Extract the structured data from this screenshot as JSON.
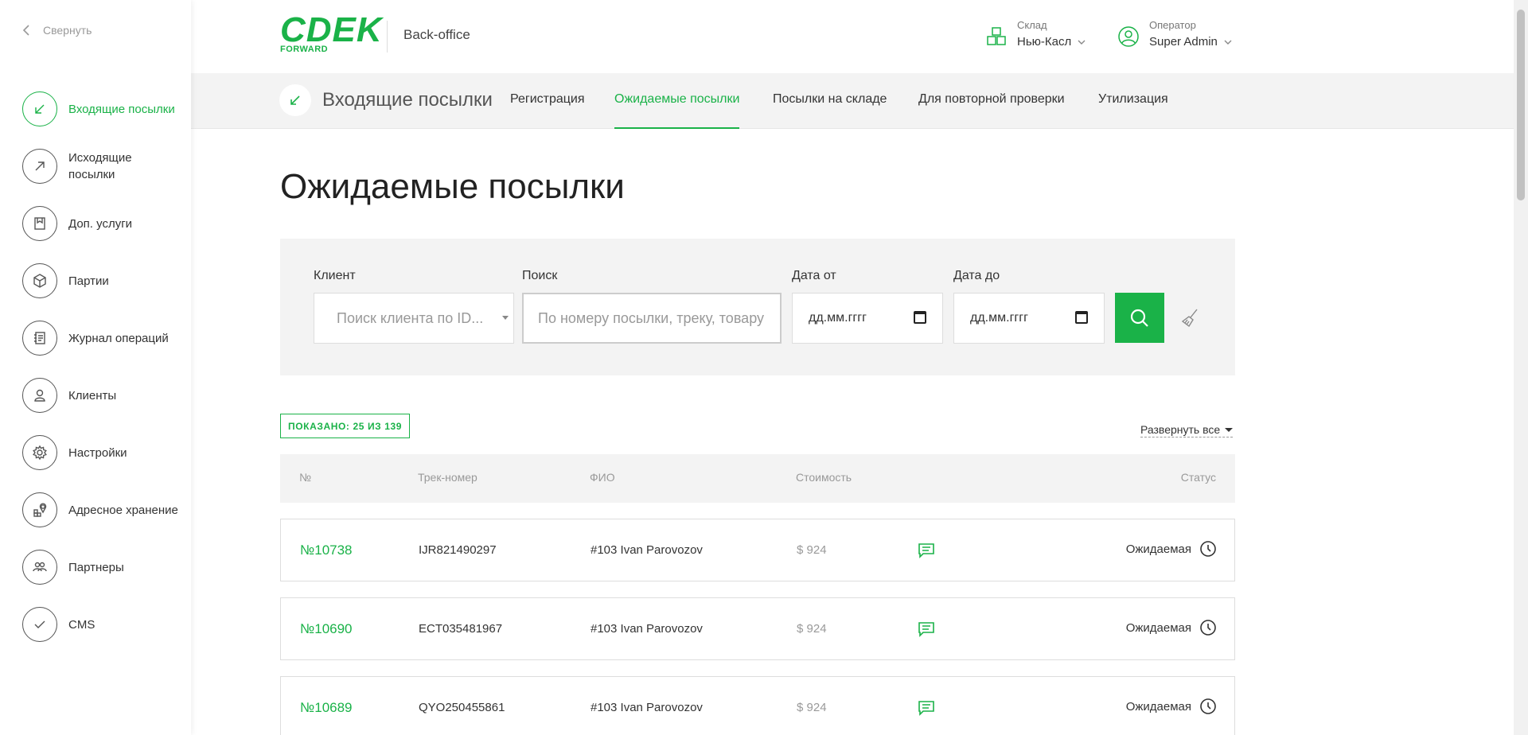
{
  "sidebar": {
    "collapse_label": "Свернуть",
    "items": [
      {
        "label": "Входящие посылки",
        "icon": "arrow-down-left-icon",
        "active": true
      },
      {
        "label": "Исходящие посылки",
        "icon": "arrow-up-right-icon",
        "active": false
      },
      {
        "label": "Доп. услуги",
        "icon": "bookmark-icon",
        "active": false
      },
      {
        "label": "Партии",
        "icon": "box-icon",
        "active": false
      },
      {
        "label": "Журнал операций",
        "icon": "journal-icon",
        "active": false
      },
      {
        "label": "Клиенты",
        "icon": "user-icon",
        "active": false
      },
      {
        "label": "Настройки",
        "icon": "gear-icon",
        "active": false
      },
      {
        "label": "Адресное хранение",
        "icon": "storage-pin-icon",
        "active": false
      },
      {
        "label": "Партнеры",
        "icon": "partners-icon",
        "active": false
      },
      {
        "label": "CMS",
        "icon": "check-icon",
        "active": false
      }
    ]
  },
  "header": {
    "logo_main": "CDEK",
    "logo_sub": "FORWARD",
    "app_name": "Back-office",
    "warehouse": {
      "caption": "Склад",
      "value": "Нью-Касл"
    },
    "operator": {
      "caption": "Оператор",
      "value": "Super Admin"
    }
  },
  "tabs": {
    "section_title": "Входящие посылки",
    "items": [
      {
        "label": "Регистрация",
        "active": false
      },
      {
        "label": "Ожидаемые посылки",
        "active": true
      },
      {
        "label": "Посылки на складе",
        "active": false
      },
      {
        "label": "Для повторной проверки",
        "active": false
      },
      {
        "label": "Утилизация",
        "active": false
      }
    ]
  },
  "page_title": "Ожидаемые посылки",
  "filters": {
    "client": {
      "label": "Клиент",
      "placeholder": "Поиск клиента по ID..."
    },
    "search": {
      "label": "Поиск",
      "placeholder": "По номеру посылки, треку, товару"
    },
    "date_from": {
      "label": "Дата от",
      "placeholder": "дд.мм.гггг"
    },
    "date_to": {
      "label": "Дата до",
      "placeholder": "дд.мм.гггг"
    }
  },
  "list": {
    "shown_badge": "ПОКАЗАНО: 25 ИЗ 139",
    "expand_all": "Развернуть все",
    "columns": {
      "num": "№",
      "track": "Трек-номер",
      "name": "ФИО",
      "cost": "Стоимость",
      "status": "Статус"
    },
    "rows": [
      {
        "num": "№10738",
        "track": "IJR821490297",
        "name": "#103 Ivan Parovozov",
        "cost": "$ 924",
        "status": "Ожидаемая"
      },
      {
        "num": "№10690",
        "track": "ECT035481967",
        "name": "#103 Ivan Parovozov",
        "cost": "$ 924",
        "status": "Ожидаемая"
      },
      {
        "num": "№10689",
        "track": "QYO250455861",
        "name": "#103 Ivan Parovozov",
        "cost": "$ 924",
        "status": "Ожидаемая"
      }
    ]
  },
  "colors": {
    "accent": "#1ab248",
    "panel": "#f3f3f3"
  }
}
